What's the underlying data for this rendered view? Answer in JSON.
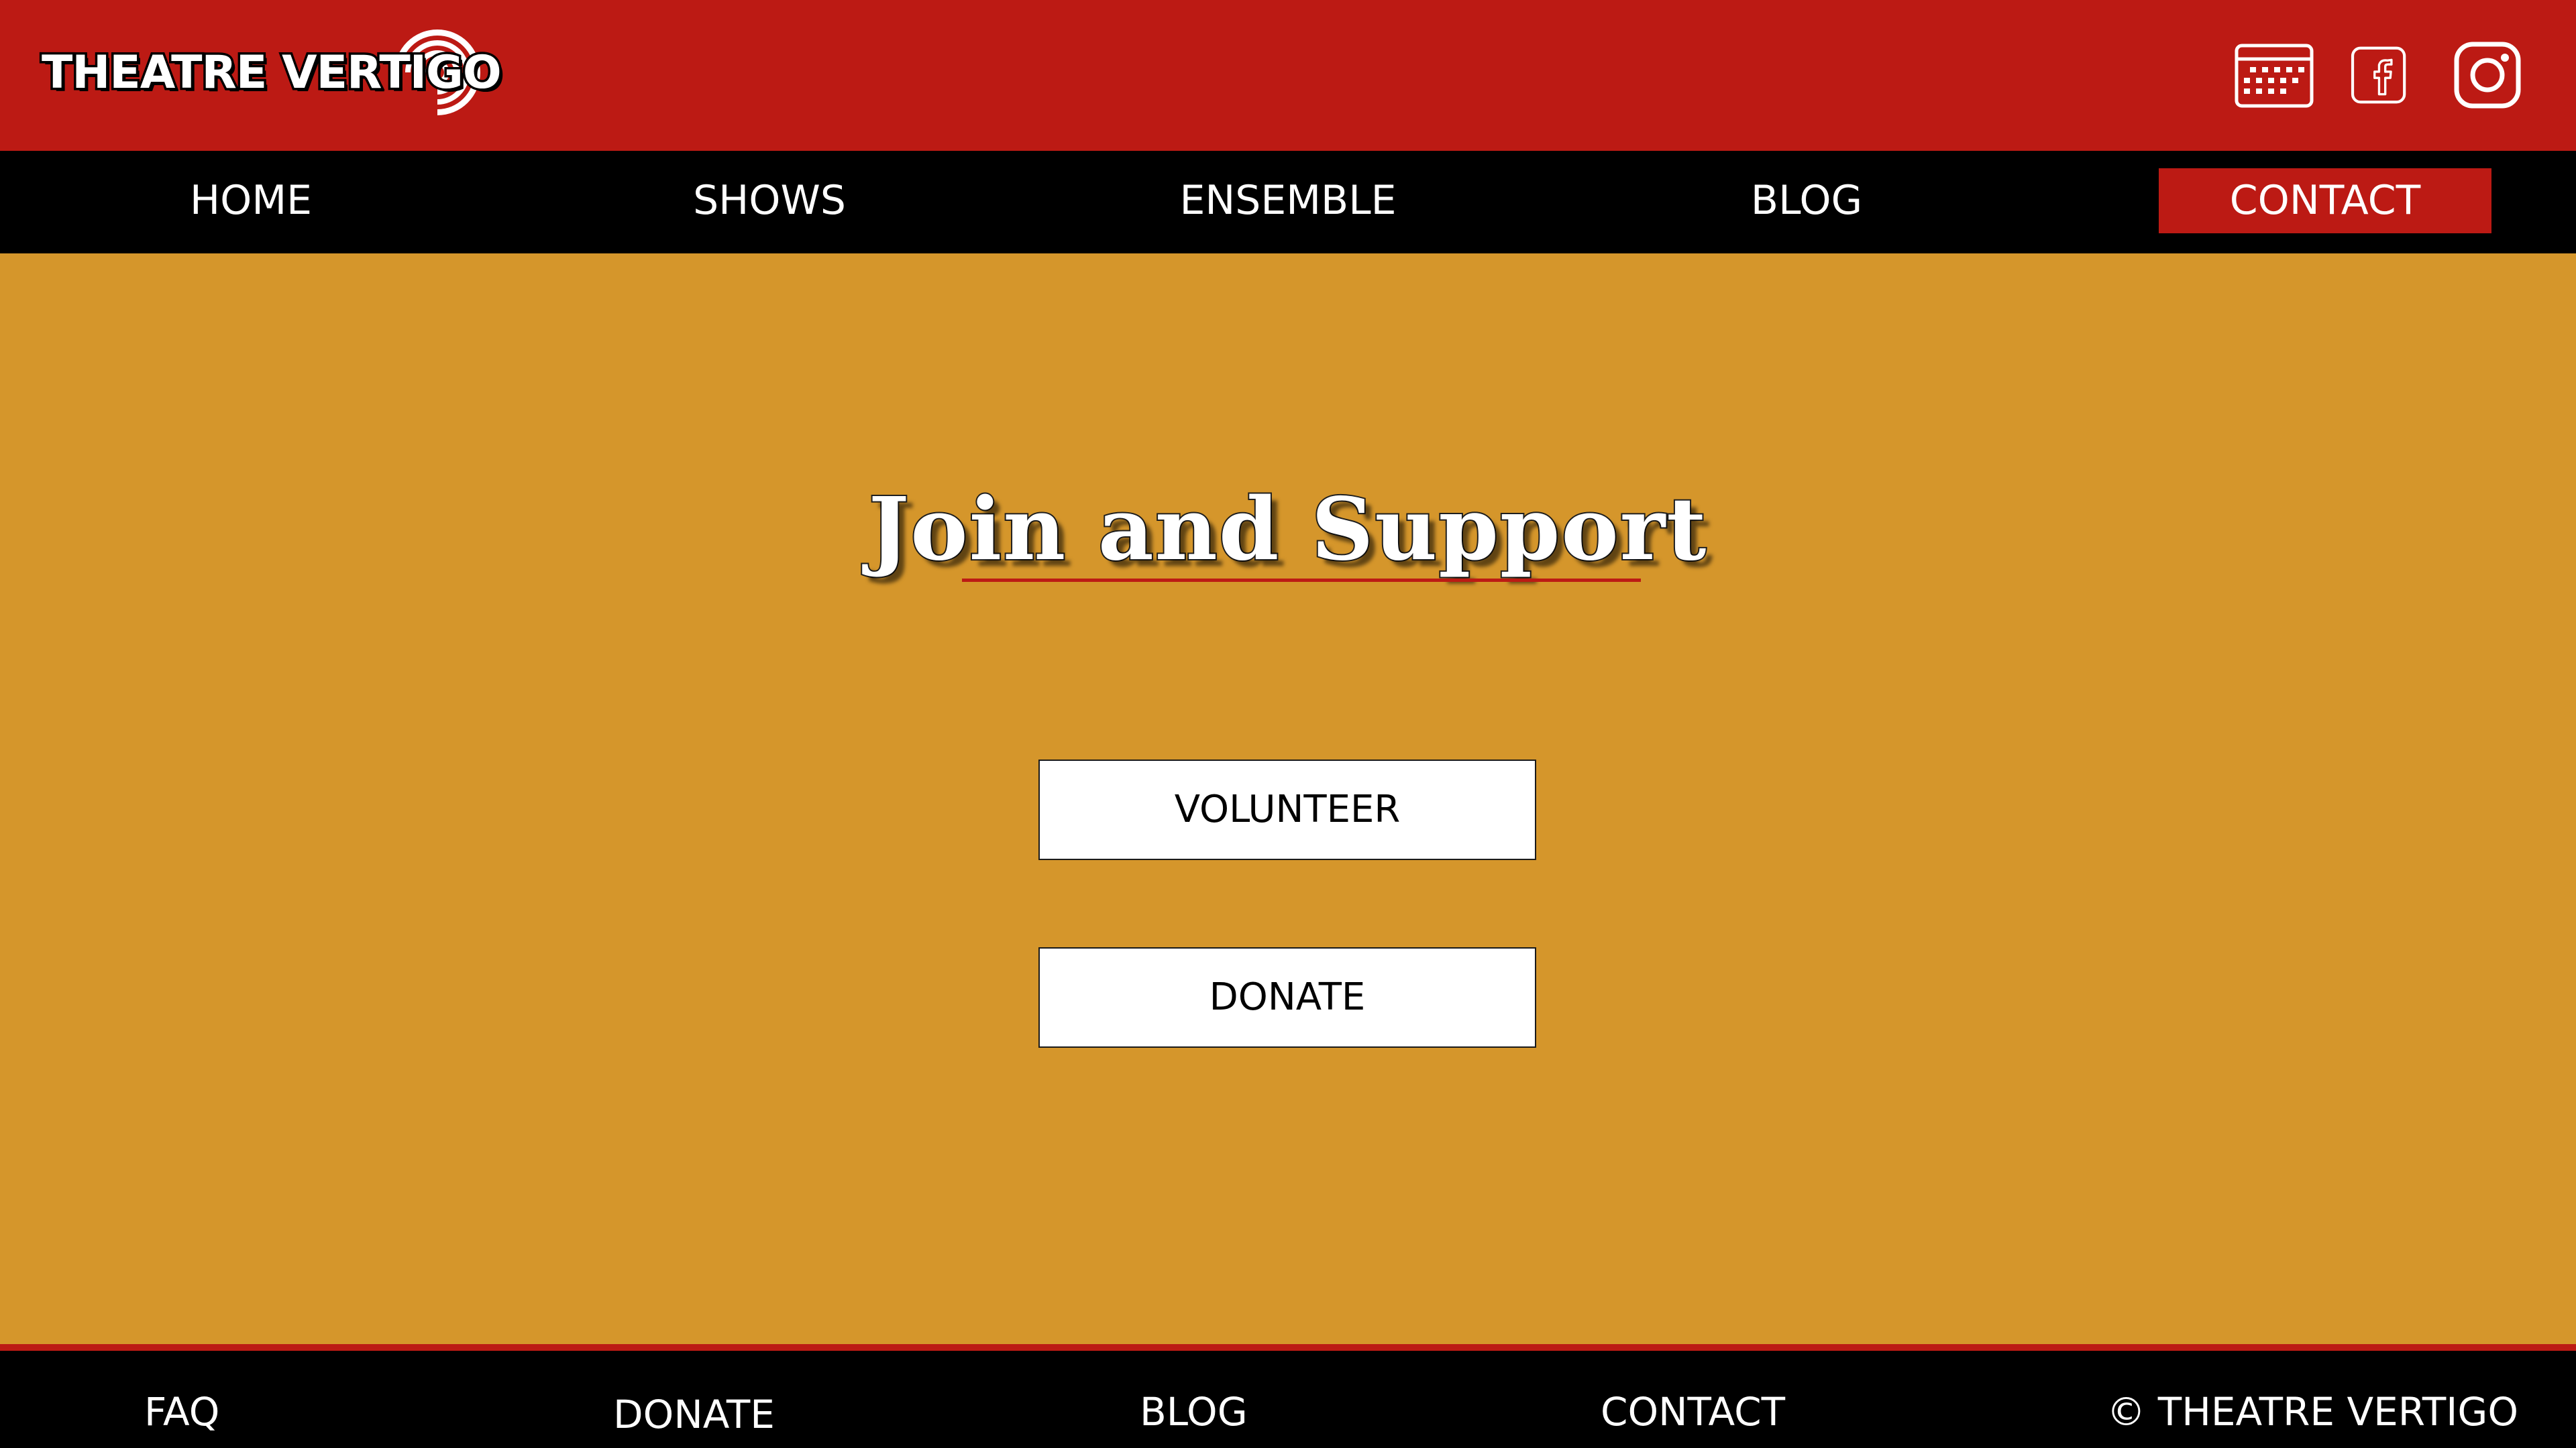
{
  "brand": {
    "name": "THEATRE VERTIGO"
  },
  "header": {
    "icons": [
      "calendar-icon",
      "facebook-icon",
      "instagram-icon"
    ]
  },
  "nav": {
    "items": [
      {
        "label": "HOME"
      },
      {
        "label": "SHOWS"
      },
      {
        "label": "ENSEMBLE"
      },
      {
        "label": "BLOG"
      },
      {
        "label": "CONTACT",
        "active": true
      }
    ]
  },
  "main": {
    "heading": "Join and Support",
    "buttons": [
      {
        "label": "VOLUNTEER"
      },
      {
        "label": "DONATE"
      }
    ]
  },
  "footer": {
    "links": [
      {
        "label": "FAQ"
      },
      {
        "label": "DONATE"
      },
      {
        "label": "BLOG"
      },
      {
        "label": "CONTACT"
      }
    ],
    "copyright": "© THEATRE VERTIGO"
  },
  "colors": {
    "header_red": "#bc1a14",
    "nav_black": "#000000",
    "page_gold": "#d5962b",
    "button_white": "#ffffff"
  }
}
